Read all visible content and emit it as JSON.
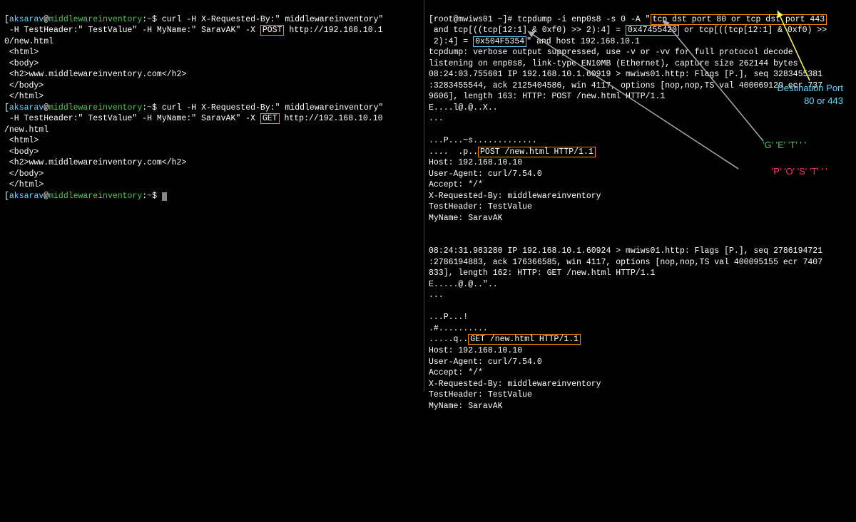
{
  "left": {
    "prompt_open": "[",
    "user": "aksarav",
    "at": "@",
    "host": "middlewareinventory",
    "colon": ":",
    "tilde": "~",
    "prompt_close": "$ ",
    "cmd1_a": "curl -H X-Requested-By:\" middlewareinventory\"",
    "cmd1_b": " -H TestHeader:\" TestValue\" -H MyName:\" SaravAK\" -X ",
    "cmd1_method": "POST",
    "cmd1_c": " http://192.168.10.1",
    "cmd1_d": "0/new.html",
    "out_html_open": " <html>",
    "out_body_open": " <body>",
    "out_h2": " <h2>www.middlewareinventory.com</h2>",
    "out_body_close": " </body>",
    "out_html_close": " </html>",
    "cmd2_a": "curl -H X-Requested-By:\" middlewareinventory\"",
    "cmd2_b": " -H TestHeader:\" TestValue\" -H MyName:\" SaravAK\" -X ",
    "cmd2_method": "GET",
    "cmd2_c": " http://192.168.10.10",
    "cmd2_d": "/new.html"
  },
  "right": {
    "prompt": "[root@mwiws01 ~]# ",
    "cmd_a": "tcpdump -i enp0s8 -s 0 -A ",
    "cmd_quote": "\"",
    "filter1": "tcp dst port 80 or tcp dst port 443",
    "filter2a": " and tcp[((tcp[12:1] & 0xf0) >> 2):4] = ",
    "hex_get": "0x47455420",
    "filter2b": " or tcp[((tcp[12:1] & 0xf0) >>",
    "filter3a": " 2):4] = ",
    "hex_post": "0x504F5354",
    "filter3b": "\"",
    "filter3c": " and host 192.168.10.1",
    "verbose": "tcpdump: verbose output suppressed, use -v or -vv for full protocol decode",
    "listening": "listening on enp0s8, link-type EN10MB (Ethernet), capture size 262144 bytes",
    "pkt1a": "08:24:03.755601 IP 192.168.10.1.60919 > mwiws01.http: Flags [P.], seq 3283455381",
    "pkt1b": ":3283455544, ack 2125404586, win 4117, options [nop,nop,TS val 400069129 ecr 737",
    "pkt1c": "9606], length 163: HTTP: POST /new.html HTTP/1.1",
    "pkt1d": "E....l@.@..X..",
    "pkt1e": "...",
    "pkt1f": "...P...~s.............",
    "pkt1g_a": "....  .p..",
    "pkt1g_box": "POST /new.html HTTP/1.1",
    "pkt1_host": "Host: 192.168.10.10",
    "pkt1_ua": "User-Agent: curl/7.54.0",
    "pkt1_accept": "Accept: */*",
    "pkt1_xrb": "X-Requested-By: middlewareinventory",
    "pkt1_th": "TestHeader: TestValue",
    "pkt1_mn": "MyName: SaravAK",
    "pkt2a": "08:24:31.983280 IP 192.168.10.1.60924 > mwiws01.http: Flags [P.], seq 2786194721",
    "pkt2b": ":2786194883, ack 176366585, win 4117, options [nop,nop,TS val 400095155 ecr 7407",
    "pkt2c": "833], length 162: HTTP: GET /new.html HTTP/1.1",
    "pkt2d": "E.....@.@..\"..",
    "pkt2e": "...",
    "pkt2f": "...P...!",
    "pkt2g": ".#..........",
    "pkt2h_a": ".....q..",
    "pkt2h_box": "GET /new.html HTTP/1.1",
    "pkt2_host": "Host: 192.168.10.10",
    "pkt2_ua": "User-Agent: curl/7.54.0",
    "pkt2_accept": "Accept: */*",
    "pkt2_xrb": "X-Requested-By: middlewareinventory",
    "pkt2_th": "TestHeader: TestValue",
    "pkt2_mn": "MyName: SaravAK"
  },
  "annotations": {
    "destport": "Destination Port\n80 or 443",
    "get_chars": "'G' 'E' 'T' ' '",
    "post_chars": "'P' 'O' 'S' 'T' ' '"
  }
}
